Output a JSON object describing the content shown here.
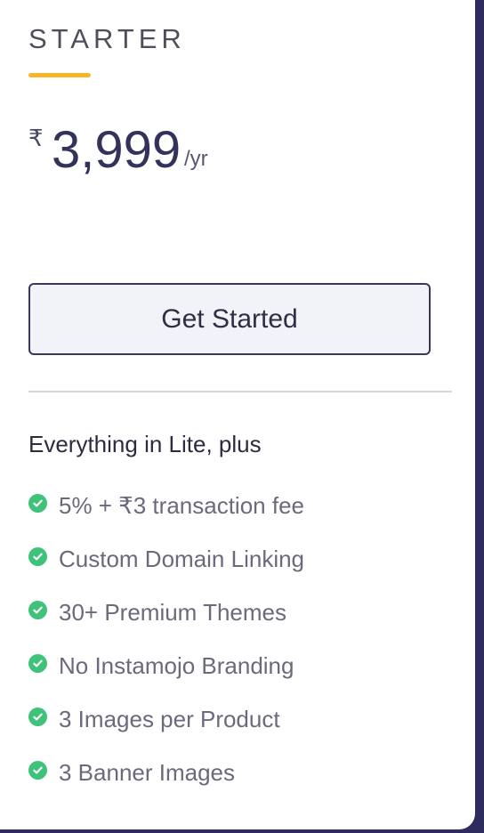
{
  "plan": {
    "name": "STARTER",
    "currency_symbol": "₹",
    "price": "3,999",
    "period": "/yr"
  },
  "cta": {
    "label": "Get Started"
  },
  "features": {
    "heading": "Everything in Lite, plus",
    "items": [
      {
        "label": "5% + ₹3 transaction fee",
        "icon": "check-circle-icon"
      },
      {
        "label": "Custom Domain Linking",
        "icon": "check-circle-icon"
      },
      {
        "label": "30+ Premium Themes",
        "icon": "check-circle-icon"
      },
      {
        "label": "No Instamojo Branding",
        "icon": "check-circle-icon"
      },
      {
        "label": "3 Images per Product",
        "icon": "check-circle-icon"
      },
      {
        "label": "3 Banner Images",
        "icon": "check-circle-icon"
      }
    ]
  },
  "colors": {
    "accent_underline": "#f7b62a",
    "check": "#3fc37b",
    "background_edge": "#2e2c5e"
  }
}
